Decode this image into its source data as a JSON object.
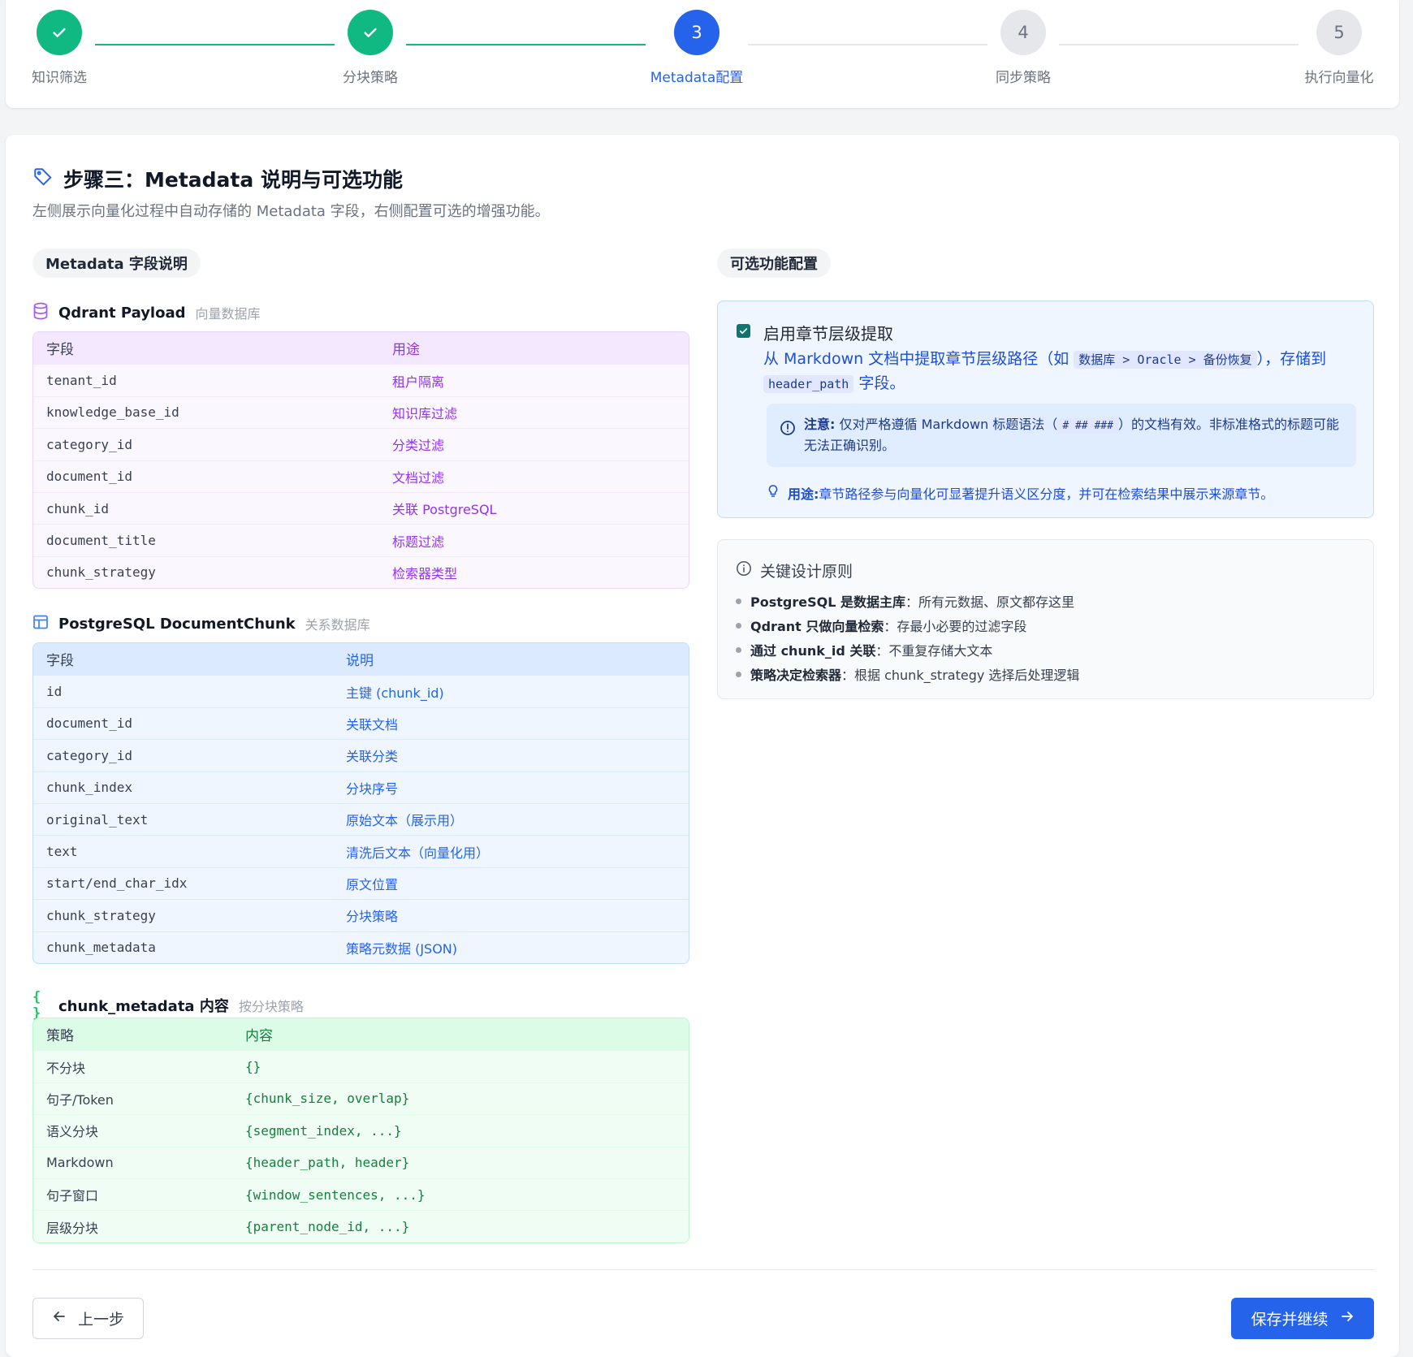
{
  "stepper": {
    "steps": [
      {
        "label": "知识筛选",
        "state": "done",
        "number": ""
      },
      {
        "label": "分块策略",
        "state": "done",
        "number": ""
      },
      {
        "label": "Metadata配置",
        "state": "active",
        "number": "3"
      },
      {
        "label": "同步策略",
        "state": "pending",
        "number": "4"
      },
      {
        "label": "执行向量化",
        "state": "pending",
        "number": "5"
      }
    ]
  },
  "header": {
    "title": "步骤三：Metadata 说明与可选功能",
    "subtitle": "左侧展示向量化过程中自动存储的 Metadata 字段，右侧配置可选的增强功能。",
    "icon": "tag-icon"
  },
  "left": {
    "pill": "Metadata 字段说明",
    "qdrant": {
      "name": "Qdrant Payload",
      "sub": "向量数据库",
      "headers": [
        "字段",
        "用途"
      ],
      "rows": [
        [
          "tenant_id",
          "租户隔离"
        ],
        [
          "knowledge_base_id",
          "知识库过滤"
        ],
        [
          "category_id",
          "分类过滤"
        ],
        [
          "document_id",
          "文档过滤"
        ],
        [
          "chunk_id",
          "关联 PostgreSQL"
        ],
        [
          "document_title",
          "标题过滤"
        ],
        [
          "chunk_strategy",
          "检索器类型"
        ]
      ]
    },
    "postgres": {
      "name": "PostgreSQL DocumentChunk",
      "sub": "关系数据库",
      "headers": [
        "字段",
        "说明"
      ],
      "rows": [
        [
          "id",
          "主键 (chunk_id)"
        ],
        [
          "document_id",
          "关联文档"
        ],
        [
          "category_id",
          "关联分类"
        ],
        [
          "chunk_index",
          "分块序号"
        ],
        [
          "original_text",
          "原始文本（展示用）"
        ],
        [
          "text",
          "清洗后文本（向量化用）"
        ],
        [
          "start/end_char_idx",
          "原文位置"
        ],
        [
          "chunk_strategy",
          "分块策略"
        ],
        [
          "chunk_metadata",
          "策略元数据 (JSON)"
        ]
      ]
    },
    "chunk_meta": {
      "icon_text": "{ }",
      "name": "chunk_metadata 内容",
      "sub": "按分块策略",
      "headers": [
        "策略",
        "内容"
      ],
      "rows": [
        [
          "不分块",
          "{}"
        ],
        [
          "句子/Token",
          "{chunk_size, overlap}"
        ],
        [
          "语义分块",
          "{segment_index, ...}"
        ],
        [
          "Markdown",
          "{header_path, header}"
        ],
        [
          "句子窗口",
          "{window_sentences, ...}"
        ],
        [
          "层级分块",
          "{parent_node_id, ...}"
        ]
      ]
    }
  },
  "right": {
    "pill": "可选功能配置",
    "feature": {
      "checked": true,
      "title": "启用章节层级提取",
      "desc_prefix": "从 Markdown 文档中提取章节层级路径（如",
      "desc_path_1": "数据库",
      "desc_sep_1": ">",
      "desc_path_2": "Oracle",
      "desc_sep_2": ">",
      "desc_path_3": "备份恢复",
      "desc_mid": "），存储到",
      "desc_field": "header_path",
      "desc_suffix": "字段。",
      "notice_label": "注意:",
      "notice_text_1": "仅对严格遵循 Markdown 标题语法（",
      "notice_code": "# ## ###",
      "notice_text_2": "）的文档有效。非标准格式的标题可能无法正确识别。",
      "usage_label": "用途:",
      "usage_text": "章节路径参与向量化可显著提升语义区分度，并可在检索结果中展示来源章节。"
    },
    "principles": {
      "title": "关键设计原则",
      "items": [
        {
          "bold": "PostgreSQL 是数据主库",
          "text": "：所有元数据、原文都存这里"
        },
        {
          "bold": "Qdrant 只做向量检索",
          "text": "：存最小必要的过滤字段"
        },
        {
          "bold": "通过 chunk_id 关联",
          "text": "：不重复存储大文本"
        },
        {
          "bold": "策略决定检索器",
          "text": "：根据 chunk_strategy 选择后处理逻辑"
        }
      ]
    }
  },
  "footer": {
    "prev_label": "上一步",
    "next_label": "保存并继续"
  },
  "colors": {
    "primary": "#2563eb",
    "success": "#10b981",
    "purple": "#9333ea",
    "green": "#15803d"
  }
}
